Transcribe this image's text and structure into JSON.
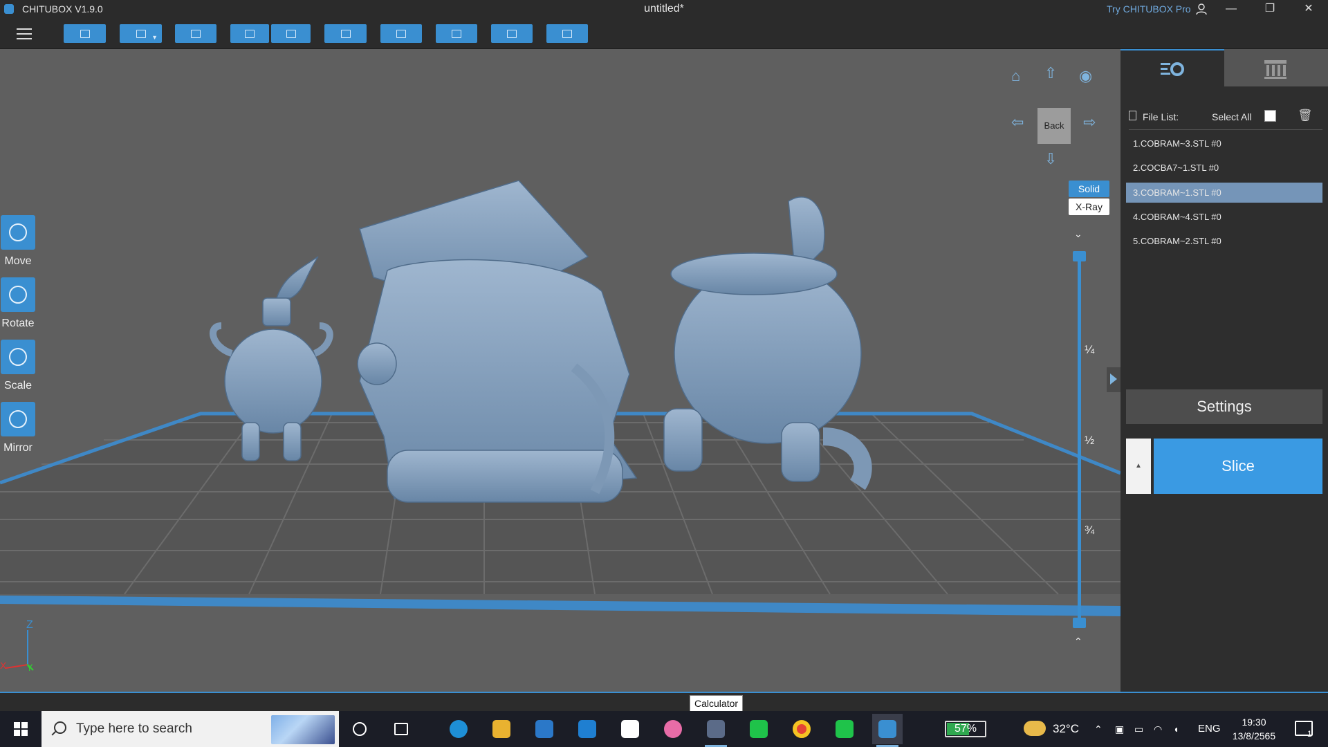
{
  "titlebar": {
    "app_name": "CHITUBOX V1.9.0",
    "document_title": "untitled*",
    "try_pro": "Try CHITUBOX Pro",
    "minimize_glyph": "—",
    "restore_glyph": "❐",
    "close_glyph": "✕"
  },
  "toolbar": {
    "buttons": [
      "open-file",
      "save",
      "screenshot",
      "undo",
      "redo",
      "copy",
      "arrange",
      "support",
      "hollow",
      "machine"
    ]
  },
  "tools": {
    "move": "Move",
    "rotate": "Rotate",
    "scale": "Scale",
    "mirror": "Mirror"
  },
  "view": {
    "back_label": "Back",
    "solid_label": "Solid",
    "xray_label": "X-Ray",
    "slider_marks": [
      "¼",
      "½",
      "¾"
    ],
    "slider_chevron_top": "⌄",
    "slider_chevron_bottom": "⌃",
    "axis_x": "X",
    "axis_y": "Y",
    "axis_z": "Z"
  },
  "panel": {
    "file_list_label": "File List:",
    "select_all_label": "Select All",
    "files": [
      "1.COBRAM~3.STL #0",
      "2.COCBA7~1.STL #0",
      "3.COBRAM~1.STL #0",
      "4.COBRAM~4.STL #0",
      "5.COBRAM~2.STL #0"
    ],
    "selected_index": 2,
    "settings_label": "Settings",
    "slice_label": "Slice",
    "slice_up_glyph": "▲"
  },
  "tooltip": "Calculator",
  "taskbar": {
    "search_placeholder": "Type here to search",
    "battery_percent": "57%",
    "battery_level": 0.57,
    "temperature": "32°C",
    "language": "ENG",
    "time": "19:30",
    "date": "13/8/2565",
    "notification_count": "1"
  },
  "colors": {
    "accent": "#3a8fd1",
    "selected_row": "#7595b8",
    "model": "#7d98b5"
  }
}
